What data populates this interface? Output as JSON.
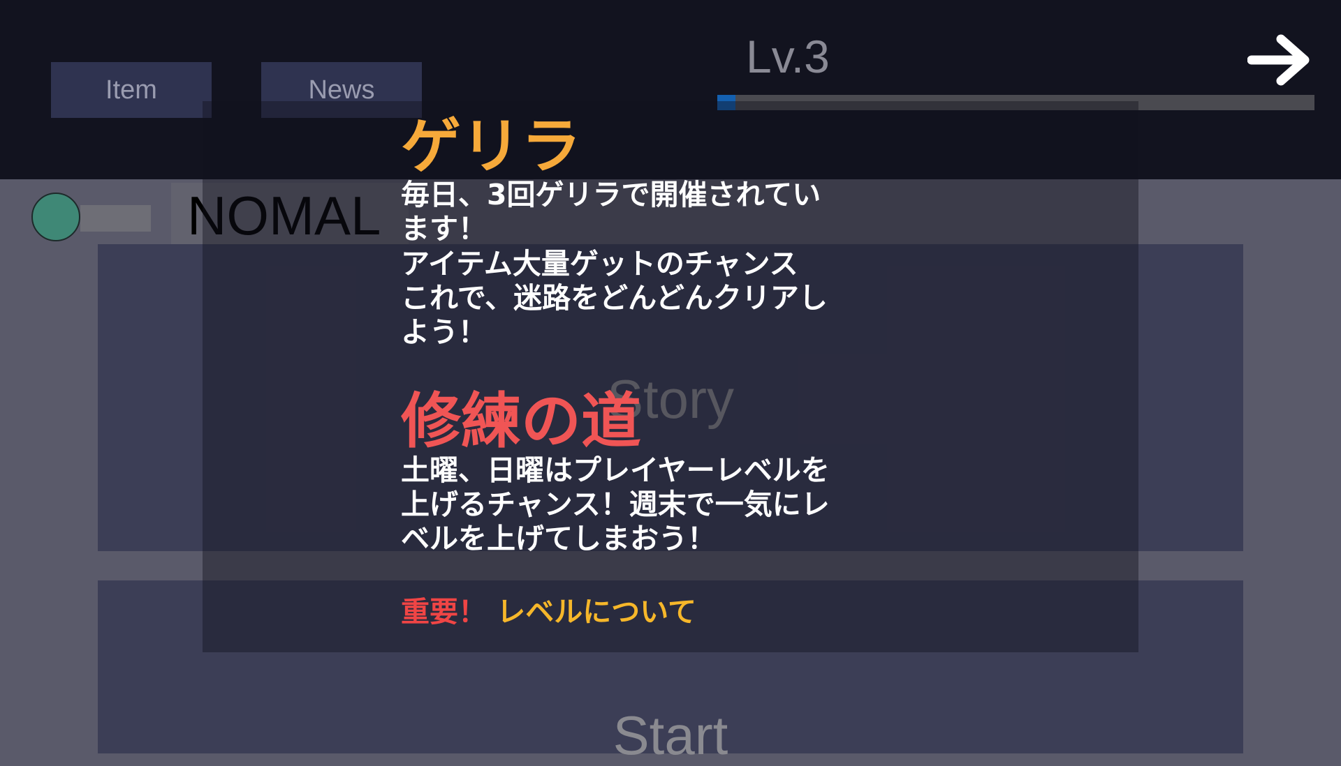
{
  "tabs": {
    "item_label": "Item",
    "news_label": "News"
  },
  "player": {
    "level_label": "Lv.3",
    "xp_progress": 0.03
  },
  "next_icon": "right-arrow-icon",
  "mode": {
    "label": "NOMAL"
  },
  "menu": {
    "story_label": "Story",
    "start_label": "Start"
  },
  "news": {
    "guerrilla_title": "ゲリラ",
    "guerrilla_body": "毎日、3回ゲリラで開催されてい\nます！\nアイテム大量ゲットのチャンス\nこれで、迷路をどんどんクリアし\nよう！",
    "training_title": "修練の道",
    "training_body": "土曜、日曜はプレイヤーレベルを\n上げるチャンス！週末で一気にレ\nベルを上げてしまおう！",
    "important_label": "重要！",
    "important_topic": "レベルについて"
  },
  "colors": {
    "guerrilla_title": "#f6a93a",
    "training_title": "#f05555",
    "important_label": "#f04545",
    "important_topic": "#f6b72a",
    "xp_fill": "#1460b0"
  }
}
